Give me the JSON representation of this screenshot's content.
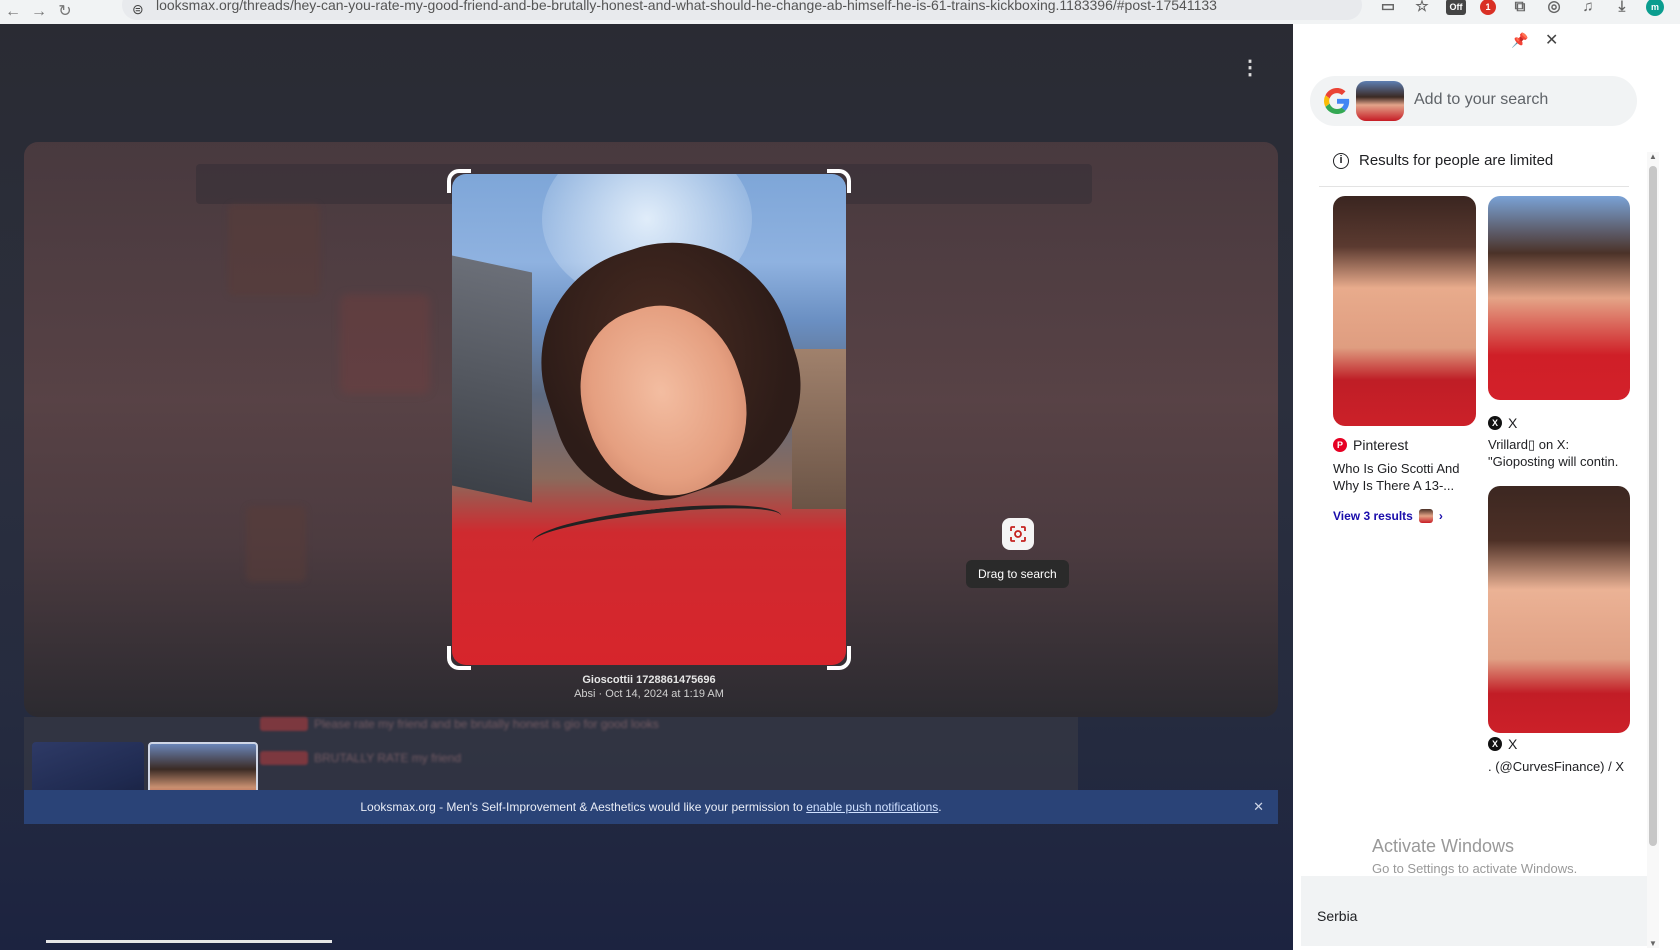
{
  "browser": {
    "url": "looksmax.org/threads/hey-can-you-rate-my-good-friend-and-be-brutally-honest-and-what-should-he-change-ab-himself-he-is-61-trains-kickboxing.1183396/#post-17541133",
    "extensions": [
      "Off",
      "1"
    ]
  },
  "viewer": {
    "image_title": "Gioscottii 1728861475696",
    "image_subtitle": "Absi · Oct 14, 2024 at 1:19 AM",
    "drag_tooltip": "Drag to search",
    "notification": {
      "text": "Looksmax.org - Men's Self-Improvement & Aesthetics would like your permission to ",
      "link": "enable push notifications",
      "end": "."
    },
    "ghost_rows": [
      "Please rate my friend and be brutally honest is gio for good looks",
      "BRUTALLY RATE my friend"
    ]
  },
  "panel": {
    "search_placeholder": "Add to your search",
    "limited_notice": "Results for people are limited",
    "results": [
      {
        "source": "Pinterest",
        "title": "Who Is Gio Scotti And Why Is There A 13-...",
        "more": "View 3 results"
      },
      {
        "source": "X",
        "title": "Vrillard▯ on X: \"Gioposting will contin."
      },
      {
        "source": "X",
        "title": ". (@CurvesFinance) / X"
      }
    ],
    "location": "Serbia"
  },
  "watermark": {
    "line1": "Activate Windows",
    "line2": "Go to Settings to activate Windows."
  }
}
